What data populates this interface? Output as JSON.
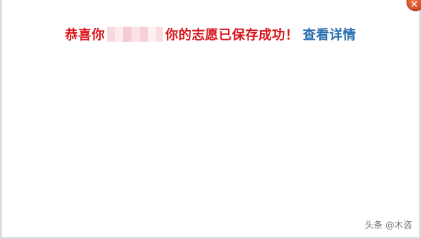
{
  "dialog": {
    "message_prefix": "恭喜你",
    "message_suffix": "你的志愿已保存成功！",
    "detail_link_label": "查看详情",
    "close_symbol": "✕"
  },
  "watermark": {
    "text": "头条 @木咨"
  },
  "colors": {
    "message_red": "#d9141a",
    "link_blue": "#2a6fb0",
    "close_orange": "#d8461f"
  },
  "icons": {
    "close": "close-icon"
  }
}
